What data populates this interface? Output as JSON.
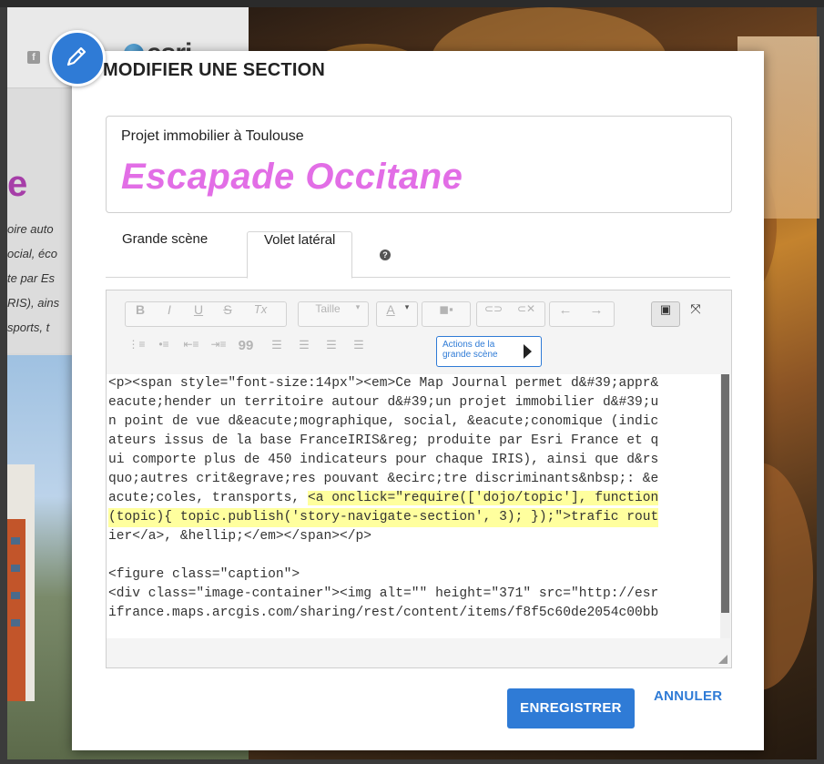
{
  "dialog": {
    "title": "MODIFIER UNE SECTION",
    "badge_icon": "pencil-icon",
    "accent_color": "#2f7bd6"
  },
  "section": {
    "subtitle": "Projet immobilier à Toulouse",
    "title": "Escapade Occitane",
    "title_color": "#e26ee6"
  },
  "tabs": [
    {
      "label": "Grande scène",
      "active": false
    },
    {
      "label": "Volet latéral",
      "active": true
    }
  ],
  "help_icon_label": "?",
  "toolbar": {
    "bold": "B",
    "italic": "I",
    "underline": "U",
    "strike": "S",
    "clear_format": "Tx",
    "size_label": "Taille",
    "font_color": "A",
    "actions_label": "Actions de la grande scène"
  },
  "code_lines": [
    "<p><span style=\"font-size:14px\"><em>Ce Map Journal permet d&#39;appr&",
    "eacute;hender un territoire autour d&#39;un projet immobilier d&#39;u",
    "n point de vue d&eacute;mographique, social, &eacute;conomique (indic",
    "ateurs issus de la base FranceIRIS&reg; produite par Esri France et q",
    "ui comporte plus de 450 indicateurs pour chaque IRIS), ainsi que d&rs",
    "quo;autres crit&egrave;res pouvant &ecirc;tre discriminants&nbsp;: &e",
    "acute;coles, transports, ",
    "(topic){ topic.publish('story-navigate-section', 3); });\">trafic rout",
    "ier</a>, &hellip;</em></span></p>",
    "",
    "<figure class=\"caption\">",
    "<div class=\"image-container\"><img alt=\"\" height=\"371\" src=\"http://esr",
    "ifrance.maps.arcgis.com/sharing/rest/content/items/f8f5c60de2054c00bb"
  ],
  "code_line7_highlight": "<a onclick=\"require(['dojo/topic'], function",
  "buttons": {
    "save": "ENREGISTRER",
    "cancel": "ANNULER"
  },
  "background": {
    "left_title": "e",
    "left_lines": [
      "oire auto",
      "ocial, éco",
      "te par Es",
      "RIS), ains",
      "sports, t"
    ],
    "fb_icon": "f",
    "brand": "esri"
  }
}
